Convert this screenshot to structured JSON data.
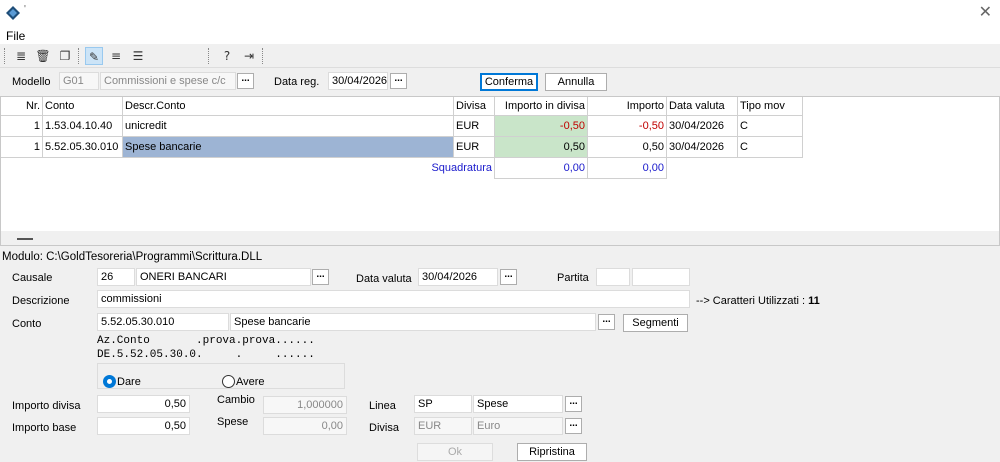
{
  "window": {
    "title_mark": "'"
  },
  "menu": {
    "file": "File"
  },
  "toolbar": {
    "icons": [
      "post-icon",
      "trash-icon",
      "copy-icon",
      "tag-icon",
      "align-left-icon",
      "list-icon",
      "help-icon",
      "exit-icon"
    ]
  },
  "header": {
    "modello_label": "Modello",
    "modello_code": "G01",
    "modello_desc": "Commissioni e spese c/c",
    "data_reg_label": "Data reg.",
    "data_reg_value": "30/04/2026",
    "ellipsis": "...",
    "confirm_label": "Conferma",
    "cancel_label": "Annulla"
  },
  "grid": {
    "columns": [
      "Nr.",
      "Conto",
      "Descr.Conto",
      "Divisa",
      "Importo in divisa",
      "Importo",
      "Data valuta",
      "Tipo mov"
    ],
    "rows": [
      {
        "nr": "1",
        "conto": "1.53.04.10.40",
        "descr": "unicredit",
        "divisa": "EUR",
        "imp_div": "-0,50",
        "importo": "-0,50",
        "data": "30/04/2026",
        "tipo": "C"
      },
      {
        "nr": "1",
        "conto": "5.52.05.30.010",
        "descr": "Spese bancarie",
        "divisa": "EUR",
        "imp_div": "0,50",
        "importo": "0,50",
        "data": "30/04/2026",
        "tipo": "C"
      }
    ],
    "squadratura_label": "Squadratura",
    "squadratura_div": "0,00",
    "squadratura_imp": "0,00"
  },
  "module_path": "Modulo: C:\\GoldTesoreria\\Programmi\\Scrittura.DLL",
  "form": {
    "causale_label": "Causale",
    "causale_code": "26",
    "causale_desc": "ONERI BANCARI",
    "data_valuta_label": "Data valuta",
    "data_valuta_value": "30/04/2026",
    "partita_label": "Partita",
    "descrizione_label": "Descrizione",
    "descrizione_value": "commissioni",
    "caratteri_label": "--> Caratteri Utilizzati :",
    "caratteri_count": "11",
    "conto_label": "Conto",
    "conto_code": "5.52.05.30.010",
    "conto_desc": "Spese bancarie",
    "segmenti_label": "Segmenti",
    "mono_line1": "Az.Conto       .prova.prova......",
    "mono_line2": "DE.5.52.05.30.0.     .     ......",
    "dare_label": "Dare",
    "avere_label": "Avere",
    "importo_divisa_label": "Importo divisa",
    "importo_divisa_value": "0,50",
    "importo_base_label": "Importo base",
    "importo_base_value": "0,50",
    "cambio_label": "Cambio",
    "cambio_value": "1,000000",
    "spese_label": "Spese",
    "spese_value": "0,00",
    "linea_label": "Linea",
    "linea_code": "SP",
    "linea_desc": "Spese",
    "divisa_label": "Divisa",
    "divisa_code": "EUR",
    "divisa_desc": "Euro",
    "ok_label": "Ok",
    "ripristina_label": "Ripristina"
  }
}
